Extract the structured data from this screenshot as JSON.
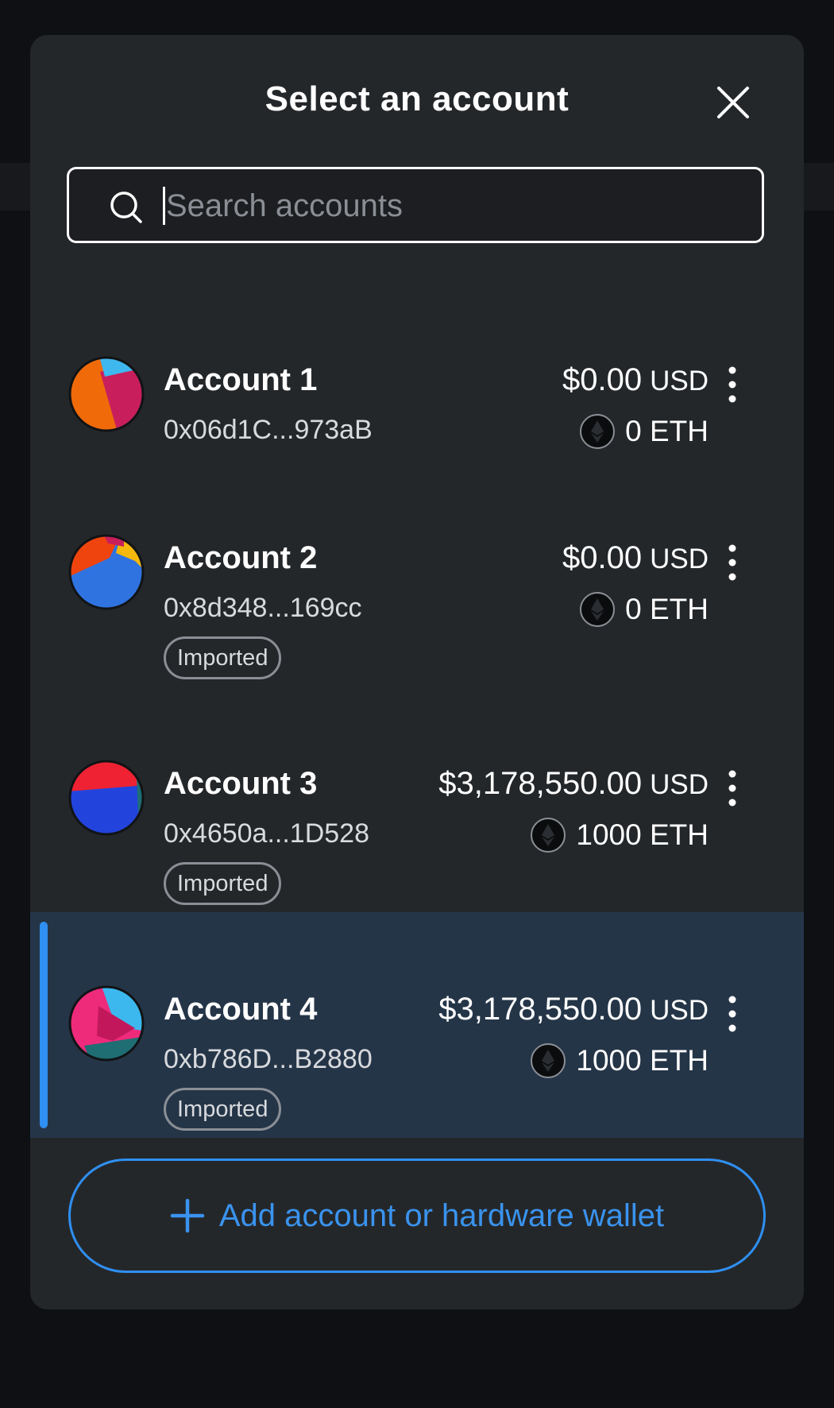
{
  "modal": {
    "title": "Select an account",
    "close_icon": "close-icon"
  },
  "search": {
    "placeholder": "Search accounts",
    "value": "",
    "icon": "search-icon"
  },
  "accounts": [
    {
      "name": "Account 1",
      "address": "0x06d1C...973aB",
      "fiat_value": "$0.00",
      "fiat_currency": "USD",
      "token_amount": "0 ETH",
      "badge": "",
      "selected": false,
      "avatar_colors": [
        "#f06a0a",
        "#c81f5c",
        "#3fb7ef"
      ]
    },
    {
      "name": "Account 2",
      "address": "0x8d348...169cc",
      "fiat_value": "$0.00",
      "fiat_currency": "USD",
      "token_amount": "0 ETH",
      "badge": "Imported",
      "selected": false,
      "avatar_colors": [
        "#2f73e0",
        "#f0440e",
        "#f5b80c"
      ]
    },
    {
      "name": "Account 3",
      "address": "0x4650a...1D528",
      "fiat_value": "$3,178,550.00",
      "fiat_currency": "USD",
      "token_amount": "1000 ETH",
      "badge": "Imported",
      "selected": false,
      "avatar_colors": [
        "#ee2233",
        "#2244dd",
        "#1e6e74"
      ]
    },
    {
      "name": "Account 4",
      "address": "0xb786D...B2880",
      "fiat_value": "$3,178,550.00",
      "fiat_currency": "USD",
      "token_amount": "1000 ETH",
      "badge": "Imported",
      "selected": true,
      "avatar_colors": [
        "#ee2a7b",
        "#3cb8ef",
        "#c2185b"
      ]
    }
  ],
  "add_button": {
    "label": "Add account or hardware wallet",
    "icon": "plus-icon"
  },
  "colors": {
    "modal_bg": "#24272a",
    "selected_row_bg": "#253548",
    "accent": "#2f8ff2"
  }
}
